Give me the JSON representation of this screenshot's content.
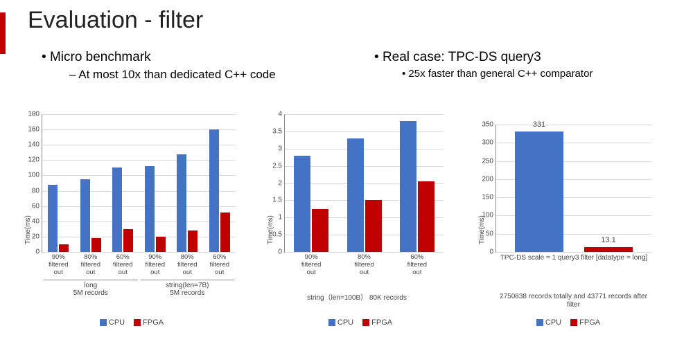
{
  "title": "Evaluation - filter",
  "left_bullet": "Micro benchmark",
  "left_sub": "At most 10x than dedicated C++ code",
  "right_bullet": "Real case: TPC-DS query3",
  "right_sub": "25x faster than general C++ comparator",
  "colors": {
    "cpu": "#4472c4",
    "fpga": "#c00000"
  },
  "legend_cpu": "CPU",
  "legend_fpga": "FPGA",
  "chart_data": [
    {
      "type": "bar",
      "ylabel": "Time(ms)",
      "ylim": [
        0,
        180
      ],
      "yticks": [
        0,
        20,
        40,
        60,
        80,
        100,
        120,
        140,
        160,
        180
      ],
      "groups": [
        "long\n5M records",
        "string(len=7B)\n5M records"
      ],
      "categories": [
        "90% filtered out",
        "80% filtered out",
        "60% filtered out",
        "90% filtered out",
        "80% filtered out",
        "60% filtered out"
      ],
      "group_map": [
        0,
        0,
        0,
        1,
        1,
        1
      ],
      "series": [
        {
          "name": "CPU",
          "values": [
            88,
            95,
            110,
            112,
            128,
            160
          ]
        },
        {
          "name": "FPGA",
          "values": [
            10,
            18,
            30,
            20,
            28,
            52
          ]
        }
      ]
    },
    {
      "type": "bar",
      "ylabel": "Time(ms)",
      "ylim": [
        0,
        4
      ],
      "yticks": [
        0,
        0.5,
        1,
        1.5,
        2,
        2.5,
        3,
        3.5,
        4
      ],
      "categories": [
        "90% filtered out",
        "80% filtered out",
        "60% filtered out"
      ],
      "subtitle": "string（len=100B）\n80K records",
      "series": [
        {
          "name": "CPU",
          "values": [
            2.8,
            3.3,
            3.8
          ]
        },
        {
          "name": "FPGA",
          "values": [
            1.25,
            1.5,
            2.05
          ]
        }
      ]
    },
    {
      "type": "bar",
      "ylabel": "Time(ms)",
      "ylim": [
        0,
        350
      ],
      "yticks": [
        0,
        50,
        100,
        150,
        200,
        250,
        300,
        350
      ],
      "categories": [
        "TPC-DS scale = 1 query3 filter [datatype = long]"
      ],
      "subtitle": "2750838 records totally and 43771 records after filter",
      "series": [
        {
          "name": "CPU",
          "values": [
            331
          ]
        },
        {
          "name": "FPGA",
          "values": [
            13.1
          ]
        }
      ],
      "data_labels": [
        "331",
        "13.1"
      ]
    }
  ]
}
